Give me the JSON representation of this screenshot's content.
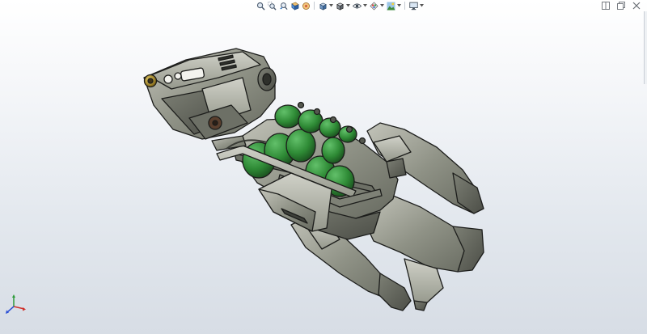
{
  "toolbar": {
    "buttons": [
      {
        "name": "zoom-to-fit-icon",
        "icon": "magnifier"
      },
      {
        "name": "zoom-to-area-icon",
        "icon": "magnifier-area"
      },
      {
        "name": "previous-view-icon",
        "icon": "previous-view"
      },
      {
        "name": "section-view-icon",
        "icon": "section"
      },
      {
        "name": "dynamic-annotation-icon",
        "icon": "annotation"
      },
      {
        "name": "view-orientation-icon",
        "icon": "cube"
      },
      {
        "name": "display-style-icon",
        "icon": "shaded"
      },
      {
        "name": "hide-show-items-icon",
        "icon": "eye"
      },
      {
        "name": "edit-appearance-icon",
        "icon": "palette"
      },
      {
        "name": "apply-scene-icon",
        "icon": "scene"
      },
      {
        "name": "view-settings-icon",
        "icon": "monitor"
      }
    ]
  },
  "window_controls": [
    {
      "name": "tile-window-icon"
    },
    {
      "name": "restore-window-icon"
    },
    {
      "name": "close-window-icon"
    }
  ],
  "colors": {
    "background_top": "#ffffff",
    "background_bottom": "#d7dde5",
    "body_gray": "#8d9084",
    "body_light": "#b7b8ae",
    "body_dark": "#5a5d55",
    "edge": "#1c1d1b",
    "accent_green": "#2e8a35",
    "accent_green_dark": "#1d5a22",
    "brass": "#a68a2a",
    "triad_x": "#d0302a",
    "triad_y": "#2e9a3a",
    "triad_z": "#2b4fd6"
  }
}
